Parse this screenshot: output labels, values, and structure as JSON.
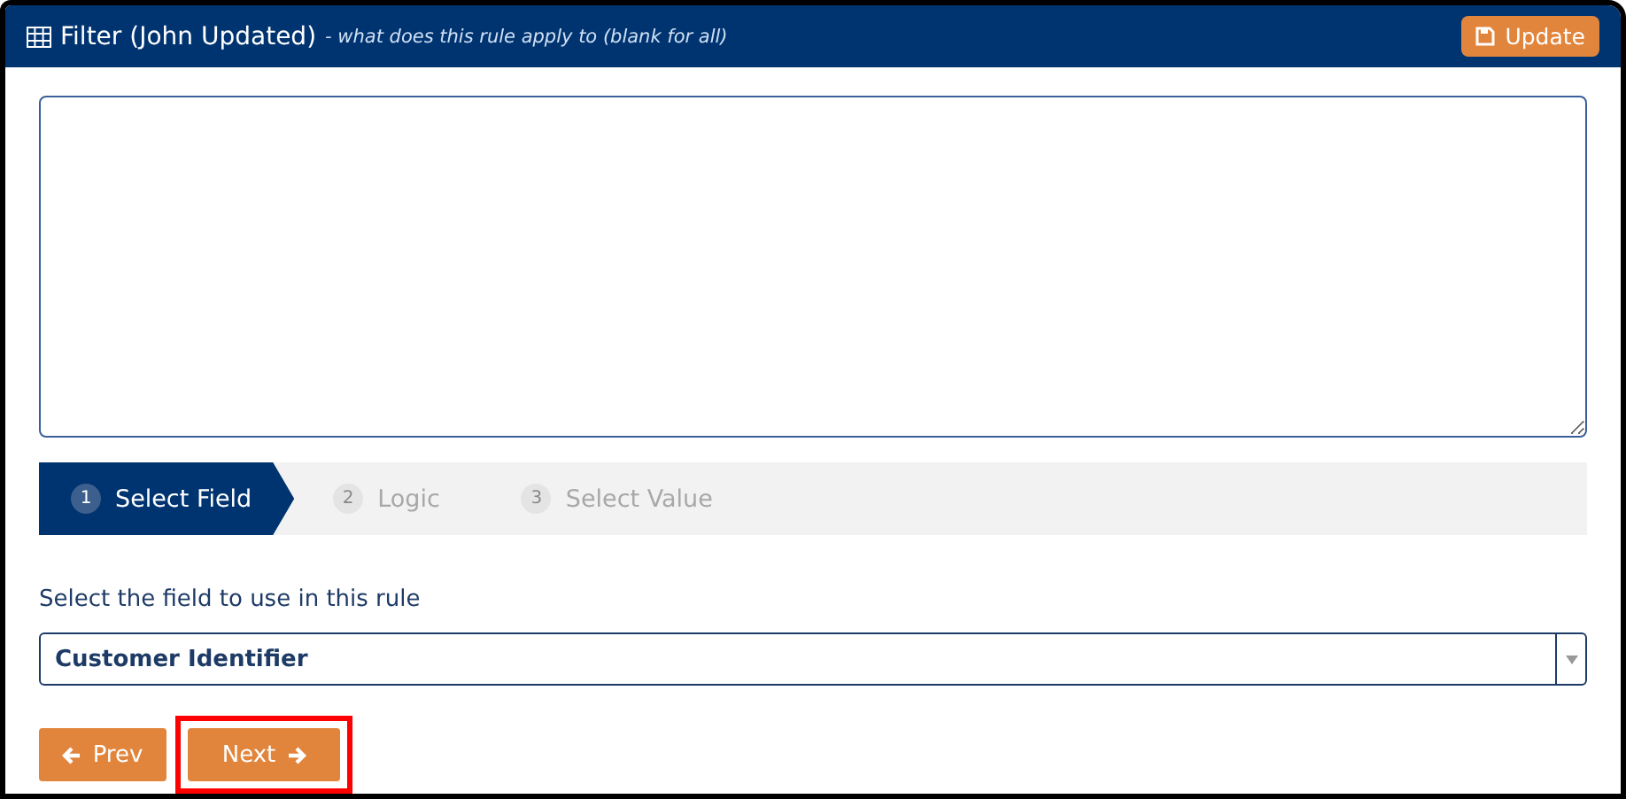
{
  "header": {
    "title": "Filter (John Updated)",
    "hint": "- what does this rule apply to (blank for all)",
    "update_button": "Update"
  },
  "steps": [
    {
      "number": "1",
      "label": "Select Field",
      "selected": true
    },
    {
      "number": "2",
      "label": "Logic",
      "selected": false
    },
    {
      "number": "3",
      "label": "Select Value",
      "selected": false
    }
  ],
  "field_label": "Select the field to use in this rule",
  "select": {
    "value": "Customer Identifier"
  },
  "buttons": [
    {
      "kind": "prev",
      "label": "Prev",
      "highlighted": false
    },
    {
      "kind": "next",
      "label": "Next",
      "highlighted": true
    }
  ]
}
